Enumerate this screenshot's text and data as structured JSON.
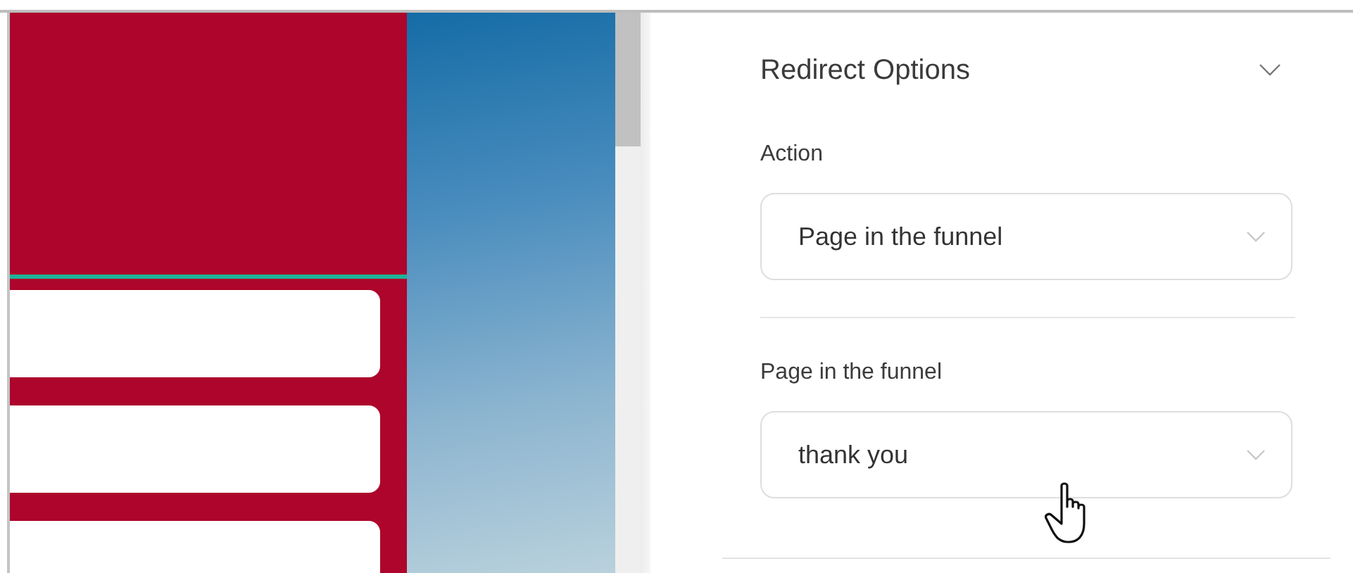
{
  "panel": {
    "title": "Redirect Options",
    "expanded": true,
    "fields": [
      {
        "label": "Action",
        "value": "Page in the funnel"
      },
      {
        "label": "Page in the funnel",
        "value": "thank you"
      }
    ]
  }
}
